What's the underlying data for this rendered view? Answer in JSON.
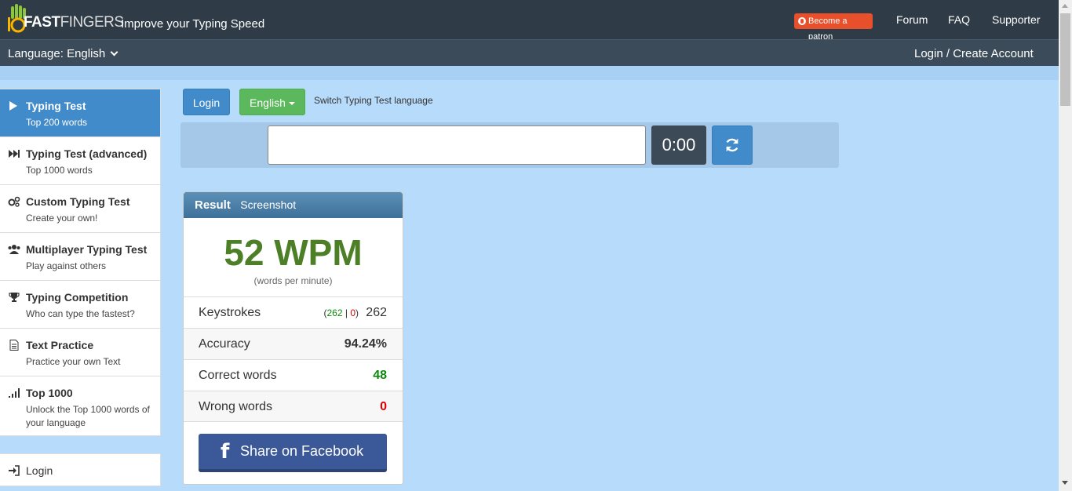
{
  "header": {
    "logo": "10FASTFINGERS",
    "tagline": "Improve your Typing Speed",
    "patron": "Become a patron",
    "nav": [
      "Forum",
      "FAQ",
      "Supporter"
    ]
  },
  "langbar": {
    "language": "Language: English",
    "account": "Login / Create Account"
  },
  "sidebar": {
    "items": [
      {
        "title": "Typing Test",
        "subtitle": "Top 200 words",
        "icon": "play-icon",
        "active": true
      },
      {
        "title": "Typing Test (advanced)",
        "subtitle": "Top 1000 words",
        "icon": "fast-forward-icon"
      },
      {
        "title": "Custom Typing Test",
        "subtitle": "Create your own!",
        "icon": "gears-icon"
      },
      {
        "title": "Multiplayer Typing Test",
        "subtitle": "Play against others",
        "icon": "users-icon"
      },
      {
        "title": "Typing Competition",
        "subtitle": "Who can type the fastest?",
        "icon": "trophy-icon"
      },
      {
        "title": "Text Practice",
        "subtitle": "Practice your own Text",
        "icon": "document-icon"
      },
      {
        "title": "Top 1000",
        "subtitle": "Unlock the Top 1000 words of your language",
        "icon": "signal-bars-icon"
      }
    ],
    "login": "Login"
  },
  "toolbar": {
    "login": "Login",
    "english": "English",
    "switch_text": "Switch Typing Test language"
  },
  "test": {
    "input_value": "",
    "timer": "0:00"
  },
  "result": {
    "title": "Result",
    "screenshot": "Screenshot",
    "wpm": "52 WPM",
    "wpm_sub": "(words per minute)",
    "keystrokes_label": "Keystrokes",
    "keystrokes_correct": "262",
    "keystrokes_sep": "|",
    "keystrokes_wrong": "0",
    "keystrokes_total": "262",
    "accuracy_label": "Accuracy",
    "accuracy": "94.24%",
    "correct_label": "Correct words",
    "correct": "48",
    "wrong_label": "Wrong words",
    "wrong": "0",
    "facebook": "Share on Facebook"
  },
  "colors": {
    "background": "#b7dbfb",
    "header": "#2f3c48",
    "primary": "#428bca",
    "success": "#5cb85c",
    "wpm": "#4c7f26",
    "facebook": "#3b5998"
  }
}
